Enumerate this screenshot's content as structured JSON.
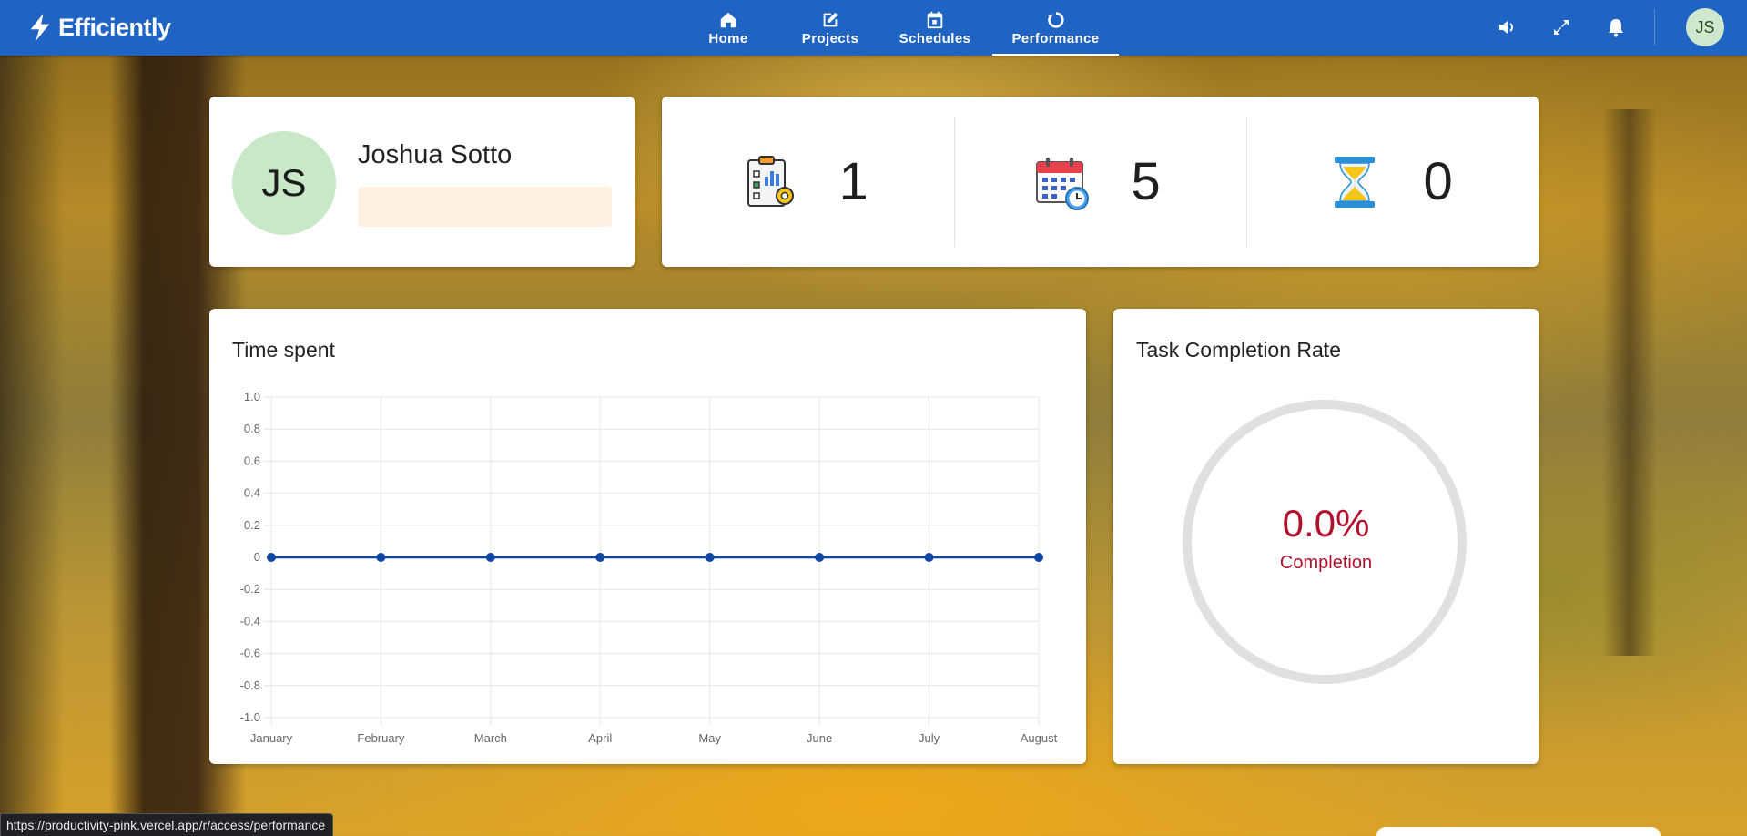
{
  "app": {
    "name": "Efficiently"
  },
  "nav": {
    "items": [
      {
        "label": "Home",
        "icon": "home-icon"
      },
      {
        "label": "Projects",
        "icon": "edit-note-icon"
      },
      {
        "label": "Schedules",
        "icon": "calendar-icon"
      },
      {
        "label": "Performance",
        "icon": "refresh-circle-icon",
        "active": true
      }
    ]
  },
  "toolbar": {
    "icons": [
      "volume-icon",
      "fullscreen-icon",
      "bell-icon"
    ],
    "avatar_initials": "JS"
  },
  "profile": {
    "initials": "JS",
    "name": "Joshua Sotto"
  },
  "stats": [
    {
      "icon": "clipboard-chart-gear-icon",
      "value": "1"
    },
    {
      "icon": "calendar-clock-icon",
      "value": "5"
    },
    {
      "icon": "hourglass-icon",
      "value": "0"
    }
  ],
  "time_spent": {
    "title": "Time spent"
  },
  "chart_data": {
    "type": "line",
    "categories": [
      "January",
      "February",
      "March",
      "April",
      "May",
      "June",
      "July",
      "August"
    ],
    "values": [
      0,
      0,
      0,
      0,
      0,
      0,
      0,
      0
    ],
    "ylim": [
      -1.0,
      1.0
    ],
    "yticks": [
      "1.0",
      "0.8",
      "0.6",
      "0.4",
      "0.2",
      "0",
      "-0.2",
      "-0.4",
      "-0.6",
      "-0.8",
      "-1.0"
    ],
    "grid": true,
    "color": "#0d47a1"
  },
  "completion": {
    "title": "Task Completion Rate",
    "value": "0.0%",
    "label": "Completion",
    "color": "#b3102d"
  },
  "status_bar": {
    "url": "https://productivity-pink.vercel.app/r/access/performance"
  },
  "colors": {
    "topbar": "#1f63c3",
    "accent": "#b3102d"
  }
}
